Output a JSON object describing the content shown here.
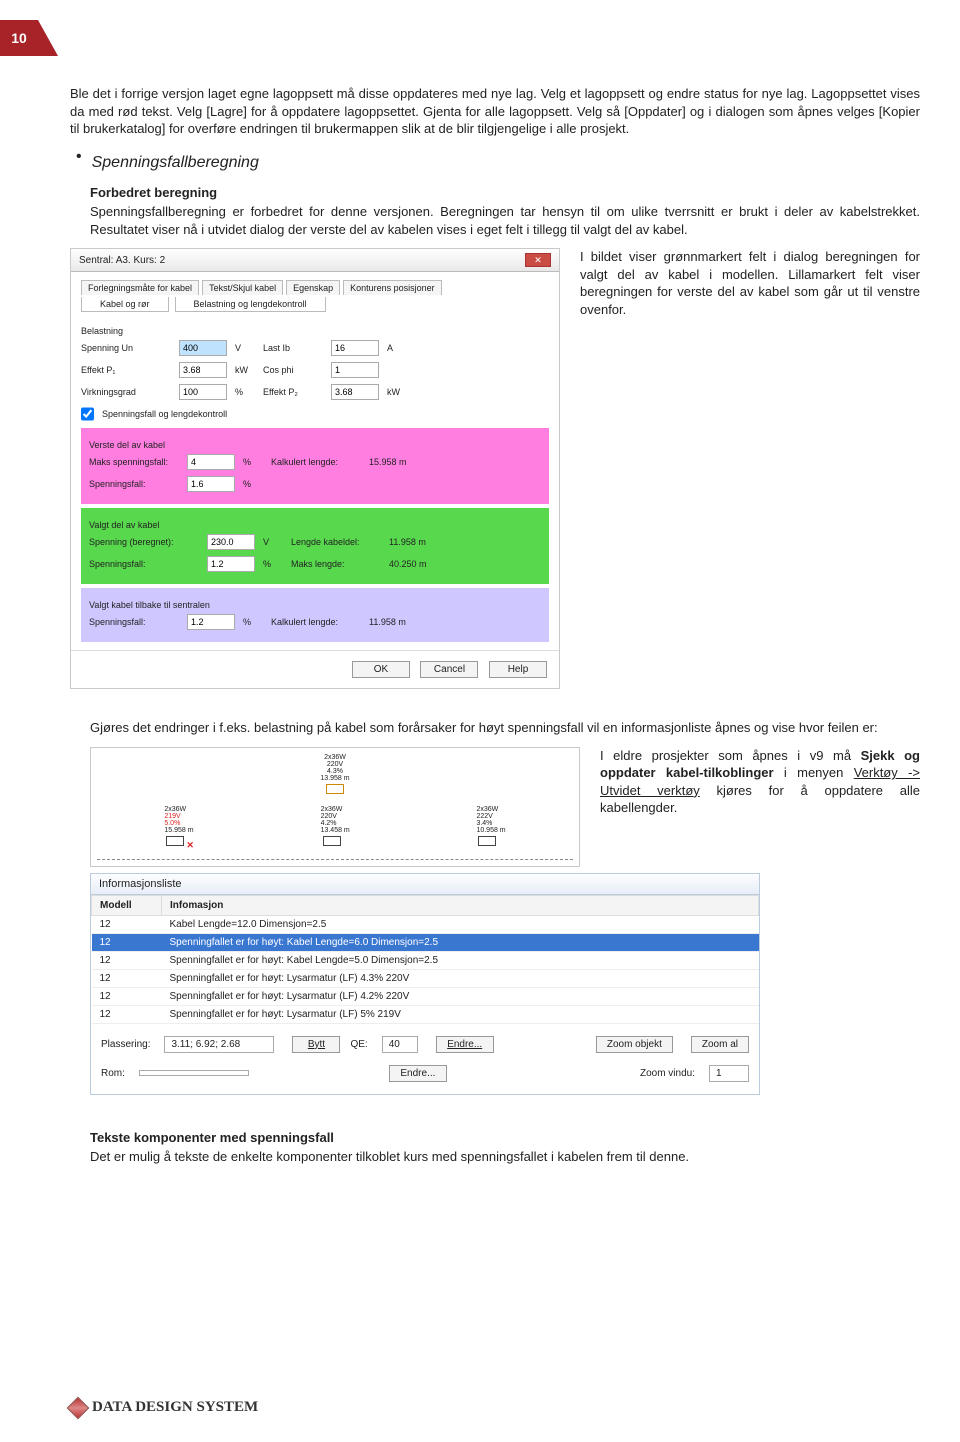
{
  "page_number": "10",
  "para1": "Ble det i forrige versjon laget egne lagoppsett må disse oppdateres med nye lag. Velg et lagoppsett og endre status for nye lag. Lagoppsettet vises da med rød tekst. Velg [Lagre] for å oppdatere lagoppsettet. Gjenta for alle lagoppsett. Velg så [Oppdater] og i dialogen som åpnes velges [Kopier til brukerkatalog] for overføre endringen til brukermappen slik at de blir tilgjengelige i alle prosjekt.",
  "section_title": "Spenningsfallberegning",
  "sub1_title": "Forbedret beregning",
  "sub1_body": "Spenningsfallberegning er forbedret for denne versjonen. Beregningen tar hensyn til om ulike tverrsnitt er brukt i deler av kabelstrekket. Resultatet viser nå i utvidet dialog der verste del av kabelen vises i eget felt i tillegg til valgt del av kabel.",
  "side1": "I bildet viser grønnmarkert felt i dialog beregningen for valgt del av kabel i modellen. Lillamarkert felt viser beregningen for verste del av kabel som går ut til venstre ovenfor.",
  "para2": "Gjøres det endringer i f.eks. belastning på kabel som forårsaker for høyt spenningsfall vil en informasjonliste åpnes og vise hvor feilen er:",
  "side2_1": "I eldre prosjekter som åpnes i v9 må ",
  "side2_bold": "Sjekk og oppdater kabel-tilkoblinger",
  "side2_2": " i menyen ",
  "side2_under": "Verktøy -> Utvidet verktøy",
  "side2_3": " kjøres for å oppdatere alle kabellengder.",
  "sub2_title": "Tekste komponenter med spenningsfall",
  "sub2_body": "Det er mulig å tekste de enkelte komponenter tilkoblet kurs med spenningsfallet i kabelen frem til denne.",
  "footer_brand_a": "DATA ",
  "footer_brand_b": "DESIGN ",
  "footer_brand_c": "SYSTEM",
  "dialog": {
    "breadcrumb": "Sentral: A3. Kurs: 2",
    "tabs": [
      "Forlegningsmåte for kabel",
      "Tekst/Skjul kabel",
      "Egenskap",
      "Konturens posisjoner"
    ],
    "tab2_a": "Kabel og rør",
    "tab2_b": "Belastning og lengdekontroll",
    "group_belastning": "Belastning",
    "rows": {
      "r1": {
        "a": "Spenning Un",
        "av": "400",
        "au": "V",
        "b": "Last Ib",
        "bv": "16",
        "bu": "A"
      },
      "r2": {
        "a": "Effekt P₁",
        "av": "3.68",
        "au": "kW",
        "b": "Cos phi",
        "bv": "1",
        "bu": ""
      },
      "r3": {
        "a": "Virkningsgrad",
        "av": "100",
        "au": "%",
        "b": "Effekt P₂",
        "bv": "3.68",
        "bu": "kW"
      }
    },
    "chk": "Spenningsfall og lengdekontroll",
    "pink": {
      "title": "Verste del av kabel",
      "a": "Maks spenningsfall:",
      "av": "4",
      "au": "%",
      "b": "Kalkulert lengde:",
      "bv": "15.958 m",
      "c": "Spenningsfall:",
      "cv": "1.6",
      "cu": "%"
    },
    "green": {
      "title": "Valgt del av kabel",
      "a": "Spenning (beregnet):",
      "av": "230.0",
      "au": "V",
      "b": "Lengde kabeldel:",
      "bv": "11.958 m",
      "c": "Spenningsfall:",
      "cv": "1.2",
      "cu": "%",
      "d": "Maks lengde:",
      "dv": "40.250 m"
    },
    "lilac": {
      "title": "Valgt kabel tilbake til sentralen",
      "a": "Spenningsfall:",
      "av": "1.2",
      "au": "%",
      "b": "Kalkulert lengde:",
      "bv": "11.958 m"
    },
    "ok": "OK",
    "cancel": "Cancel",
    "help": "Help"
  },
  "cables": {
    "top": {
      "dim": "2x36W",
      "volt": "220V",
      "pct": "4.3%",
      "len": "13.958 m"
    },
    "row": [
      {
        "dim": "2x36W",
        "volt": "219V",
        "pct": "5.0%",
        "len": "15.958 m",
        "warn": true
      },
      {
        "dim": "2x36W",
        "volt": "220V",
        "pct": "4.2%",
        "len": "13.458 m"
      },
      {
        "dim": "2x36W",
        "volt": "222V",
        "pct": "3.4%",
        "len": "10.958 m"
      }
    ]
  },
  "info": {
    "title": "Informasjonsliste",
    "h1": "Modell",
    "h2": "Infomasjon",
    "rows": [
      {
        "m": "12",
        "t": "Kabel Lengde=12.0  Dimensjon=2.5"
      },
      {
        "m": "12",
        "t": "Spenningfallet er for høyt: Kabel Lengde=6.0  Dimensjon=2.5",
        "sel": true
      },
      {
        "m": "12",
        "t": "Spenningfallet er for høyt: Kabel Lengde=5.0  Dimensjon=2.5"
      },
      {
        "m": "12",
        "t": "Spenningfallet er for høyt: Lysarmatur (LF) 4.3% 220V"
      },
      {
        "m": "12",
        "t": "Spenningfallet er for høyt: Lysarmatur (LF) 4.2% 220V"
      },
      {
        "m": "12",
        "t": "Spenningfallet er for høyt: Lysarmatur (LF) 5% 219V"
      }
    ],
    "plass_l": "Plassering:",
    "plass_v": "3.11; 6.92; 2.68",
    "bytt": "Bytt",
    "qe_l": "QE:",
    "qe_v": "40",
    "endre": "Endre...",
    "zoomobj": "Zoom objekt",
    "zoomalt": "Zoom al",
    "rom_l": "Rom:",
    "zoomvind_l": "Zoom vindu:",
    "zoomvind_v": "1"
  }
}
